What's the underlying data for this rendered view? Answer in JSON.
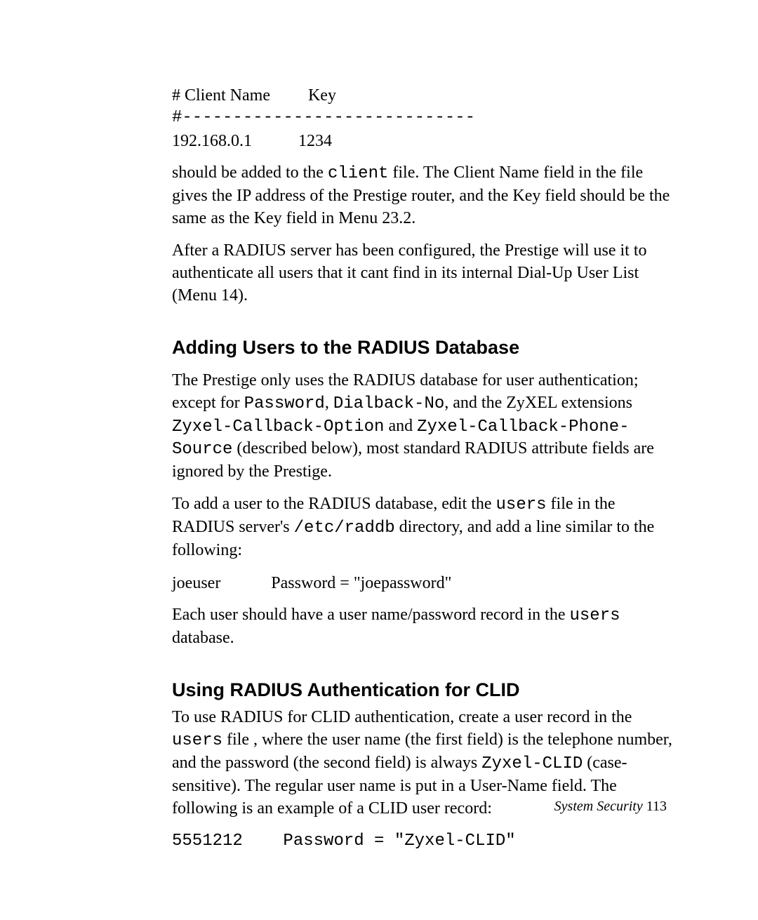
{
  "code_block_1": {
    "header": "# Client Name         Key",
    "divider": "#-----------------------------",
    "row": "192.168.0.1           1234"
  },
  "p1": {
    "a": "should be added to the ",
    "b": "client",
    "c": " file.  The Client Name field in the file gives the IP address of the Prestige router, and the Key field should be the same as the Key field in Menu 23.2."
  },
  "p2": "After a RADIUS server has been configured, the Prestige will use it to authenticate all users that it cant find in its internal Dial-Up User List (Menu 14).",
  "h1": "Adding Users to the RADIUS Database",
  "p3": {
    "a": "The Prestige only uses the RADIUS database for user authentication; except for ",
    "b": "Password",
    "c": ", ",
    "d": "Dialback-No",
    "e": ", and the ZyXEL extensions ",
    "f": "Zyxel-Callback-Option",
    "g": " and ",
    "h": "Zyxel-Callback-Phone-Source",
    "i": " (described below), most standard RADIUS attribute fields are ignored by the Prestige."
  },
  "p4": {
    "a": "To add a user to the RADIUS database, edit the ",
    "b": "users",
    "c": " file in the RADIUS server's ",
    "d": "/etc/raddb",
    "e": " directory, and add a line similar to the following:"
  },
  "example1": "joeuser            Password = \"joepassword\"",
  "p5": {
    "a": "Each user should have a user name/password record in the ",
    "b": "users",
    "c": " database."
  },
  "h2": "Using RADIUS Authentication for CLID",
  "p6": {
    "a": "To use RADIUS for CLID authentication, create a user record in the ",
    "b": "users",
    "c": " file , where the user name (the first field) is the telephone number, and the password (the second field) is always ",
    "d": "Zyxel-CLID",
    "e": " (case-sensitive).  The regular user name is put in a User-Name field. The following is an example of a CLID user record:"
  },
  "example2": "5551212    Password = \"Zyxel-CLID\"",
  "footer": {
    "label": "System Security  ",
    "page": "113"
  }
}
